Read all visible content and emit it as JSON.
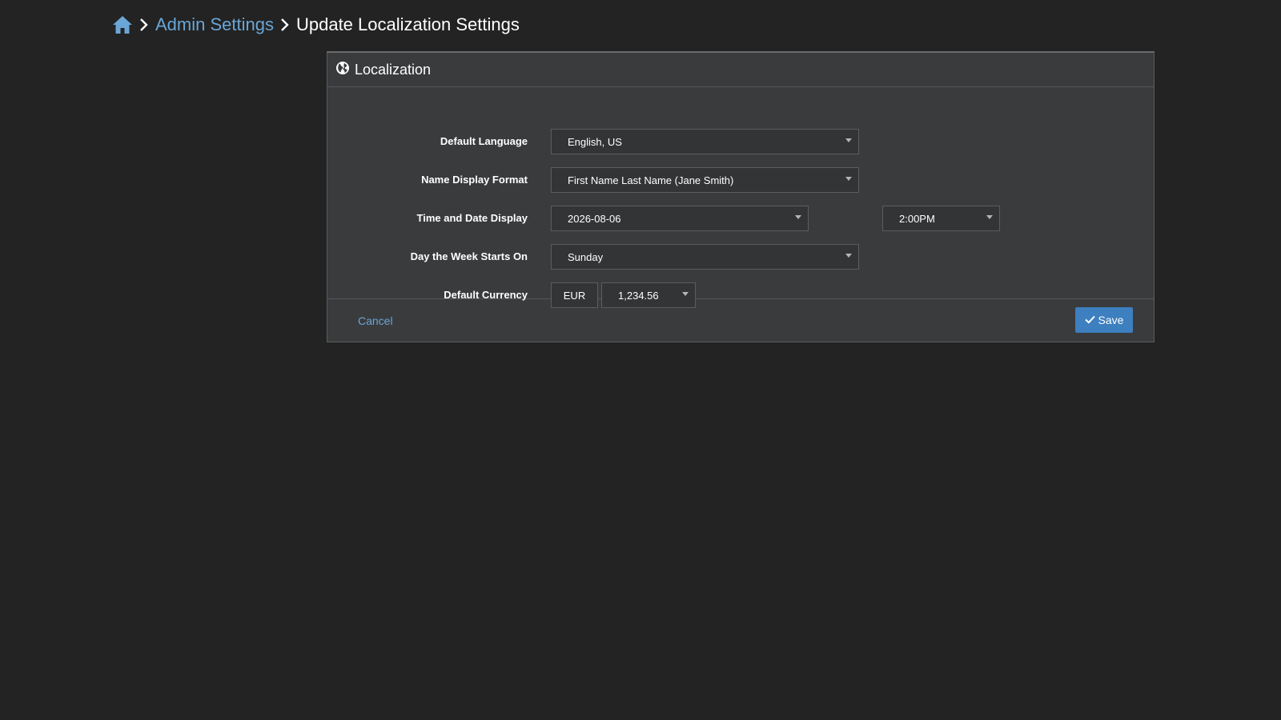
{
  "breadcrumb": {
    "home_icon": "home-icon",
    "separator_icon": "chevron-right-icon",
    "parent": "Admin Settings",
    "current": "Update Localization Settings"
  },
  "panel": {
    "icon": "globe-icon",
    "title": "Localization"
  },
  "form": {
    "default_language": {
      "label": "Default Language",
      "value": "English, US"
    },
    "name_display_format": {
      "label": "Name Display Format",
      "value": "First Name Last Name (Jane Smith)"
    },
    "time_date_display": {
      "label": "Time and Date Display",
      "date_value": "2026-08-06",
      "time_value": "2:00PM"
    },
    "week_start": {
      "label": "Day the Week Starts On",
      "value": "Sunday"
    },
    "default_currency": {
      "label": "Default Currency",
      "code": "EUR",
      "format": "1,234.56"
    }
  },
  "footer": {
    "cancel_label": "Cancel",
    "save_label": "Save",
    "save_icon": "check-icon"
  },
  "colors": {
    "background": "#232323",
    "panel": "#3a3b3d",
    "link": "#6aa6d6",
    "primary_button": "#3d7fbf"
  }
}
